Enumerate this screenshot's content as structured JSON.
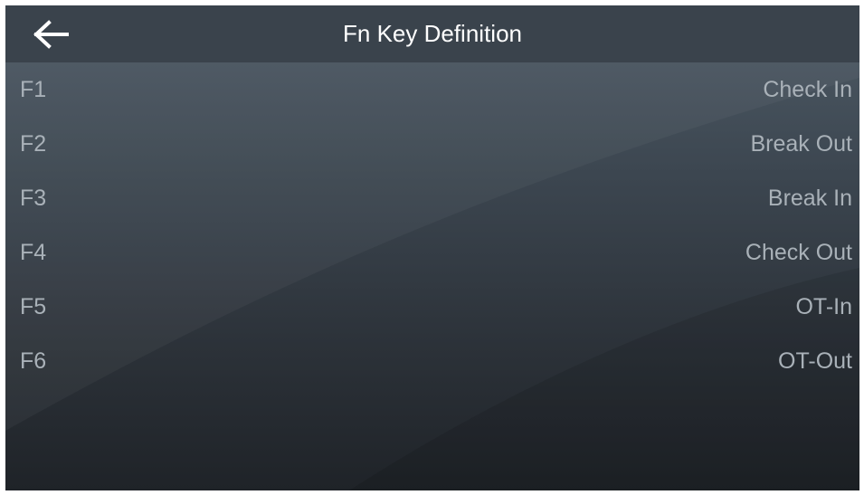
{
  "header": {
    "back_icon": "arrow-left-icon",
    "title": "Fn Key Definition"
  },
  "fn_keys": [
    {
      "key": "F1",
      "value": "Check In"
    },
    {
      "key": "F2",
      "value": "Break Out"
    },
    {
      "key": "F3",
      "value": "Break In"
    },
    {
      "key": "F4",
      "value": "Check Out"
    },
    {
      "key": "F5",
      "value": "OT-In"
    },
    {
      "key": "F6",
      "value": "OT-Out"
    }
  ],
  "colors": {
    "header_bg": "#3a434c",
    "title_text": "#ffffff",
    "row_text": "#a9b1b8"
  }
}
